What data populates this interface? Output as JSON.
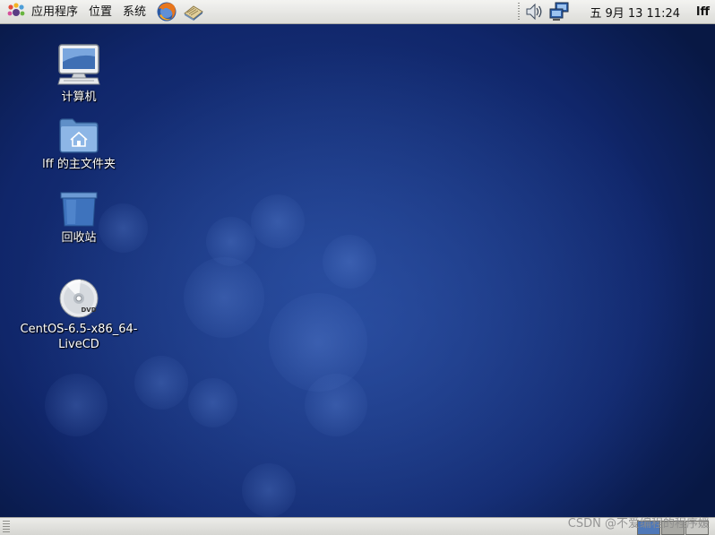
{
  "top_panel": {
    "menus": {
      "applications": "应用程序",
      "places": "位置",
      "system": "系统"
    },
    "launchers": [
      "firefox-icon",
      "mail-icon"
    ],
    "tray": [
      "volume-icon",
      "network-icon"
    ],
    "clock": "五 9月 13 11:24",
    "user": "lff"
  },
  "desktop": {
    "icons": [
      {
        "label": "计算机",
        "icon": "computer-icon"
      },
      {
        "label": "lff 的主文件夹",
        "icon": "home-folder-icon"
      },
      {
        "label": "回收站",
        "icon": "trash-icon"
      },
      {
        "label": "CentOS-6.5-x86_64-\nLiveCD",
        "icon": "dvd-icon",
        "badge": "DVD"
      }
    ]
  },
  "watermark": "CSDN @不爱编程的程序媛",
  "colors": {
    "panel": "#dcdcd8",
    "desktop_bg": "#10266a",
    "accent_blue": "#1f3f8c"
  }
}
